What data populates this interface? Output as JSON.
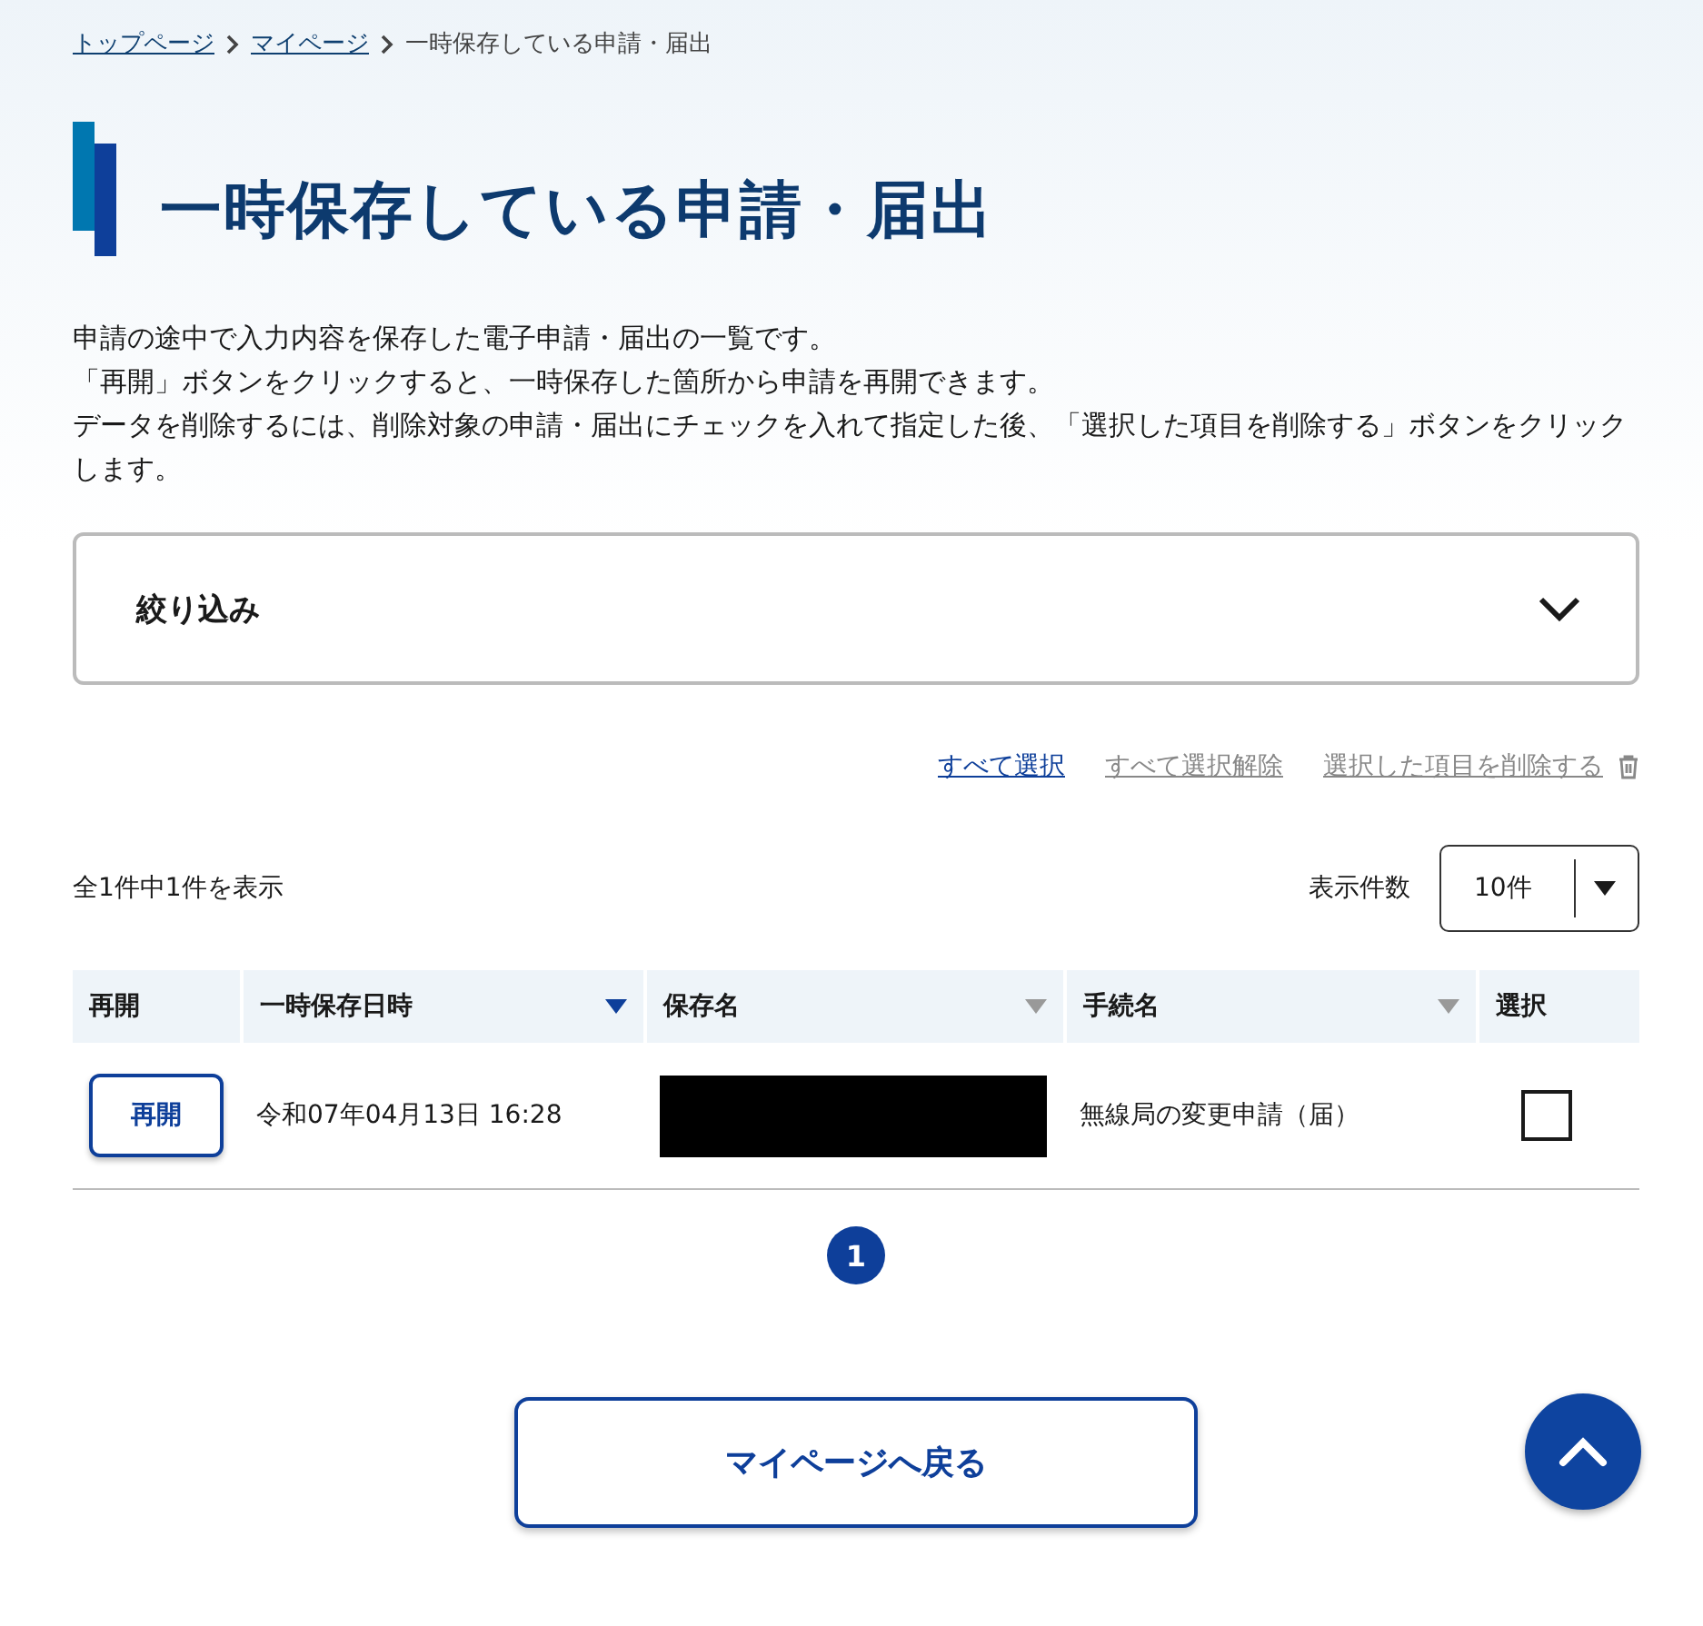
{
  "breadcrumbs": [
    {
      "label": "トップページ",
      "link": true
    },
    {
      "label": "マイページ",
      "link": true
    },
    {
      "label": "一時保存している申請・届出",
      "link": false
    }
  ],
  "title": "一時保存している申請・届出",
  "description": [
    "申請の途中で入力内容を保存した電子申請・届出の一覧です。",
    "「再開」ボタンをクリックすると、一時保存した箇所から申請を再開できます。",
    "データを削除するには、削除対象の申請・届出にチェックを入れて指定した後、「選択した項目を削除する」ボタンをクリックします。"
  ],
  "filter": {
    "label": "絞り込み",
    "expanded": false
  },
  "actions": [
    {
      "label": "すべて選択",
      "disabled": false,
      "kind": "link"
    },
    {
      "label": "すべて選択解除",
      "disabled": true,
      "kind": "link"
    },
    {
      "label": "選択した項目を削除する",
      "disabled": true,
      "kind": "delete"
    }
  ],
  "result_count": "全1件中1件を表示",
  "page_size": {
    "label": "表示件数",
    "value": "10件"
  },
  "table": {
    "columns": [
      {
        "label": "再開",
        "kind": "plain"
      },
      {
        "label": "一時保存日時",
        "kind": "sort",
        "sorted": true
      },
      {
        "label": "保存名",
        "kind": "sort",
        "sorted": false
      },
      {
        "label": "手続名",
        "kind": "sort",
        "sorted": false
      },
      {
        "label": "選択",
        "kind": "plain"
      }
    ],
    "rows": [
      {
        "button": "再開",
        "saved_at": "令和07年04月13日 16:28",
        "procedure": "無線局の変更申請（届）",
        "checked": false
      }
    ]
  },
  "pagination": [
    {
      "label": "1",
      "selected": true
    }
  ],
  "back_button": "マイページへ戻る"
}
